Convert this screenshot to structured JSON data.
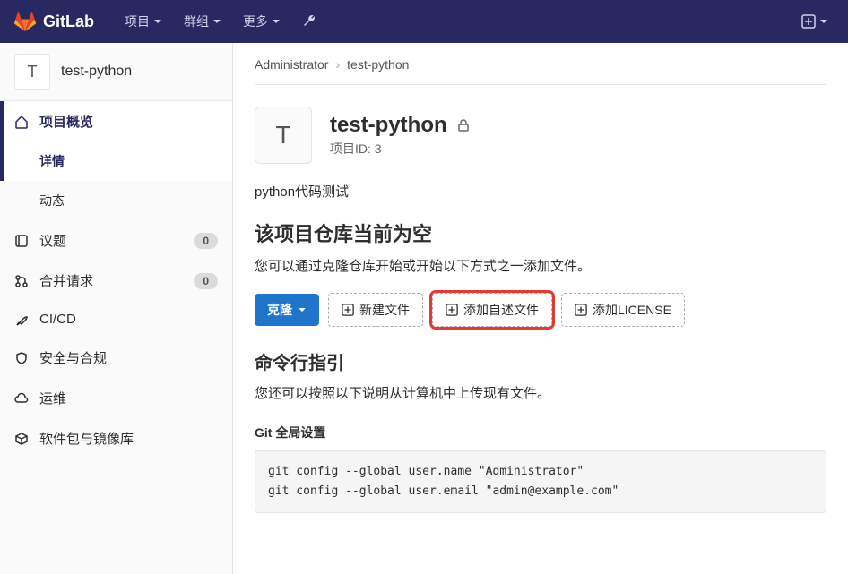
{
  "topbar": {
    "brand": "GitLab",
    "nav": [
      {
        "label": "项目"
      },
      {
        "label": "群组"
      },
      {
        "label": "更多"
      }
    ]
  },
  "sidebar": {
    "project": {
      "avatar": "T",
      "name": "test-python"
    },
    "items": [
      {
        "label": "项目概览",
        "icon": "home",
        "active": true
      },
      {
        "label": "详情",
        "sub": true,
        "active": true
      },
      {
        "label": "动态",
        "sub": true
      },
      {
        "label": "议题",
        "icon": "issues",
        "badge": "0"
      },
      {
        "label": "合并请求",
        "icon": "merge",
        "badge": "0"
      },
      {
        "label": "CI/CD",
        "icon": "rocket"
      },
      {
        "label": "安全与合规",
        "icon": "shield"
      },
      {
        "label": "运维",
        "icon": "cloud"
      },
      {
        "label": "软件包与镜像库",
        "icon": "package"
      }
    ]
  },
  "breadcrumb": {
    "owner": "Administrator",
    "project": "test-python"
  },
  "hero": {
    "avatar": "T",
    "title": "test-python",
    "id_label": "项目ID: 3"
  },
  "description": "python代码测试",
  "empty": {
    "heading": "该项目仓库当前为空",
    "sub": "您可以通过克隆仓库开始或开始以下方式之一添加文件。"
  },
  "actions": {
    "clone": "克隆",
    "new_file": "新建文件",
    "add_readme": "添加自述文件",
    "add_license": "添加LICENSE"
  },
  "cli": {
    "heading": "命令行指引",
    "sub": "您还可以按照以下说明从计算机中上传现有文件。",
    "global_heading": "Git 全局设置",
    "code": "git config --global user.name \"Administrator\"\ngit config --global user.email \"admin@example.com\""
  }
}
